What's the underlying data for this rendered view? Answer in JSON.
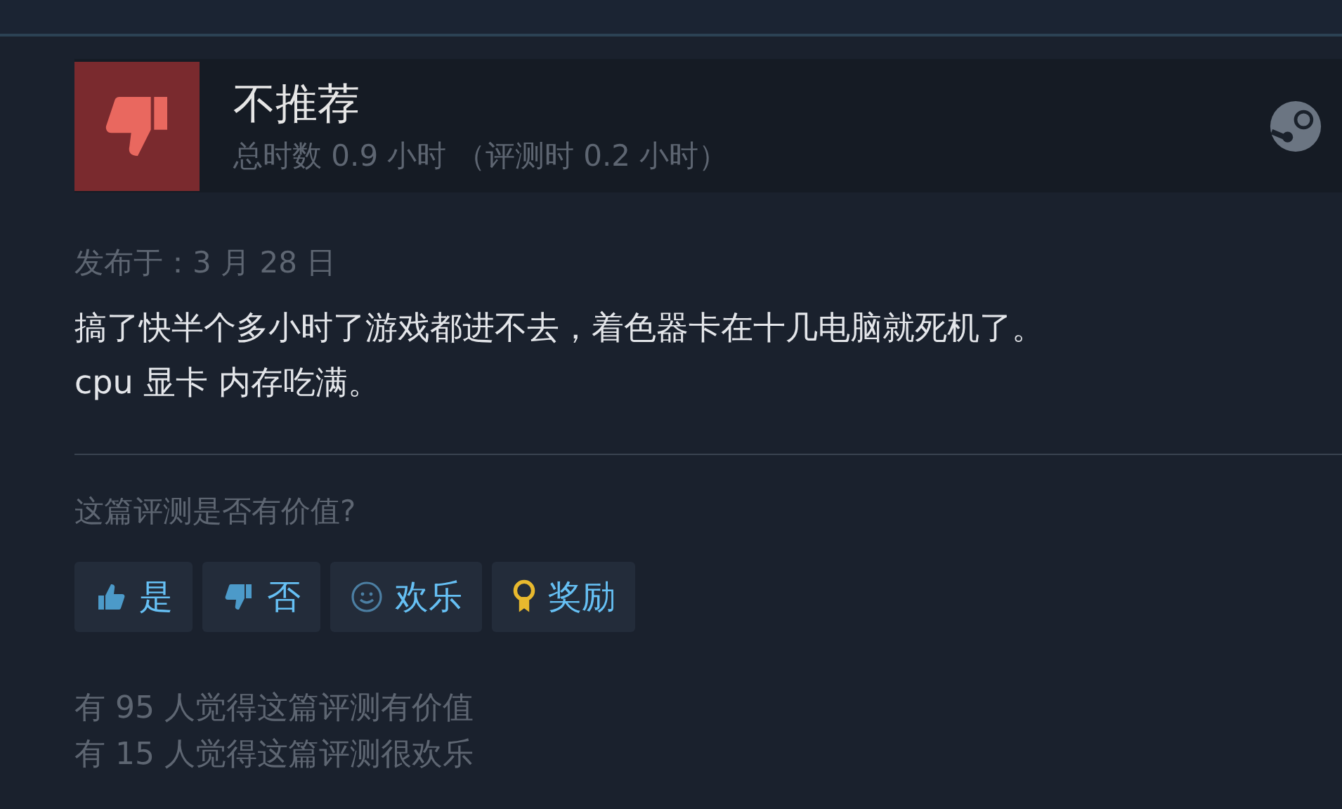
{
  "review": {
    "verdict": "不推荐",
    "recommended": false,
    "hours": "总时数 0.9 小时 （评测时 0.2 小时）",
    "posted": "发布于：3 月 28 日",
    "text": "搞了快半个多小时了游戏都进不去，着色器卡在十几电脑就死机了。\ncpu 显卡 内存吃满。"
  },
  "helpful": {
    "question": "这篇评测是否有价值?",
    "buttons": [
      {
        "kind": "up",
        "label": "是"
      },
      {
        "kind": "down",
        "label": "否"
      },
      {
        "kind": "funny",
        "label": "欢乐"
      },
      {
        "kind": "award",
        "label": "奖励"
      }
    ],
    "stats": [
      "有 95 人觉得这篇评测有价值",
      "有 15 人觉得这篇评测很欢乐"
    ]
  }
}
